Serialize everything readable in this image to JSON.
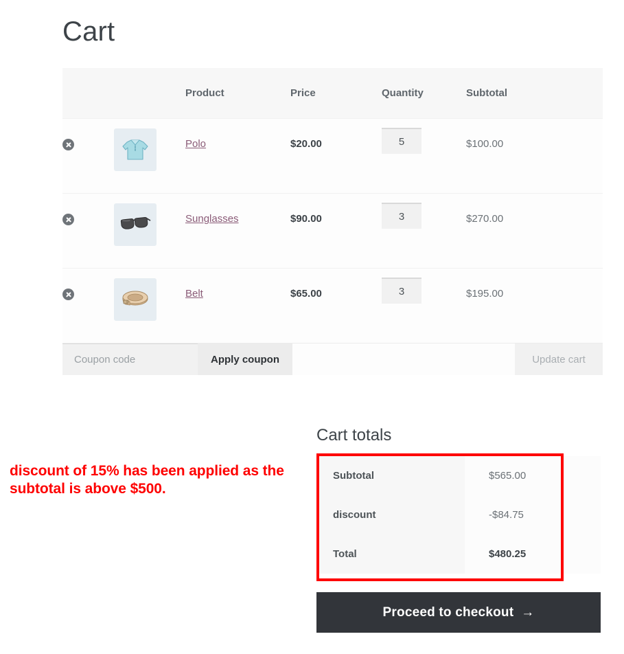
{
  "page": {
    "title": "Cart"
  },
  "cart_table": {
    "headers": {
      "remove": "",
      "thumbnail": "",
      "product": "Product",
      "price": "Price",
      "quantity": "Quantity",
      "subtotal": "Subtotal"
    },
    "rows": [
      {
        "remove_icon": "remove-circle-icon",
        "thumbnail_icon": "polo-shirt-image",
        "product": "Polo",
        "price": "$20.00",
        "quantity": "5",
        "subtotal": "$100.00"
      },
      {
        "remove_icon": "remove-circle-icon",
        "thumbnail_icon": "sunglasses-image",
        "product": "Sunglasses",
        "price": "$90.00",
        "quantity": "3",
        "subtotal": "$270.00"
      },
      {
        "remove_icon": "remove-circle-icon",
        "thumbnail_icon": "belt-image",
        "product": "Belt",
        "price": "$65.00",
        "quantity": "3",
        "subtotal": "$195.00"
      }
    ],
    "coupon": {
      "placeholder": "Coupon code",
      "value": "",
      "apply_label": "Apply coupon",
      "update_label": "Update cart"
    }
  },
  "annotation": {
    "text": "discount of 15% has been applied as the subtotal is above $500.",
    "color": "#fe0000"
  },
  "cart_totals": {
    "title": "Cart totals",
    "rows": [
      {
        "label": "Subtotal",
        "value": "$565.00"
      },
      {
        "label": "discount",
        "value": "-$84.75"
      },
      {
        "label": "Total",
        "value": "$480.25"
      }
    ],
    "checkout_label": "Proceed to checkout",
    "checkout_arrow": "→",
    "highlight_color": "#fe0000"
  }
}
